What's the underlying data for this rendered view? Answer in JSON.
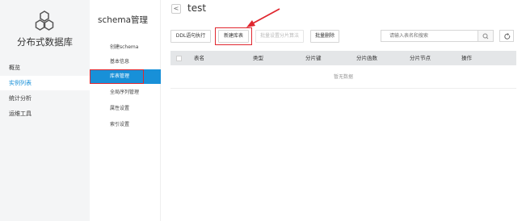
{
  "leftnav": {
    "product_name": "分布式数据库",
    "items": [
      {
        "label": "概览"
      },
      {
        "label": "实例列表"
      },
      {
        "label": "统计分析"
      },
      {
        "label": "运维工具"
      }
    ]
  },
  "subnav": {
    "title": "schema管理",
    "items": [
      {
        "label": "创建schema"
      },
      {
        "label": "基本信息"
      },
      {
        "label": "库表管理"
      },
      {
        "label": "全局序列管理"
      },
      {
        "label": "属性设置"
      },
      {
        "label": "索引设置"
      }
    ]
  },
  "main": {
    "back_label": "<",
    "title": "test",
    "toolbar": {
      "ddl_label": "DDL语句执行",
      "new_table_label": "新建库表",
      "batch_algo_label": "批量设置分片算法",
      "batch_delete_label": "批量删除"
    },
    "search": {
      "placeholder": "请输入表名和搜索"
    },
    "table": {
      "columns": [
        "表名",
        "类型",
        "分片键",
        "分片函数",
        "分片节点",
        "操作"
      ],
      "empty_text": "暂无数据"
    }
  },
  "colors": {
    "accent": "#1890d8",
    "annotation": "#e0272f"
  },
  "icons": {
    "logo": "hexagon-cluster-icon",
    "search": "search-icon",
    "refresh": "refresh-icon"
  }
}
